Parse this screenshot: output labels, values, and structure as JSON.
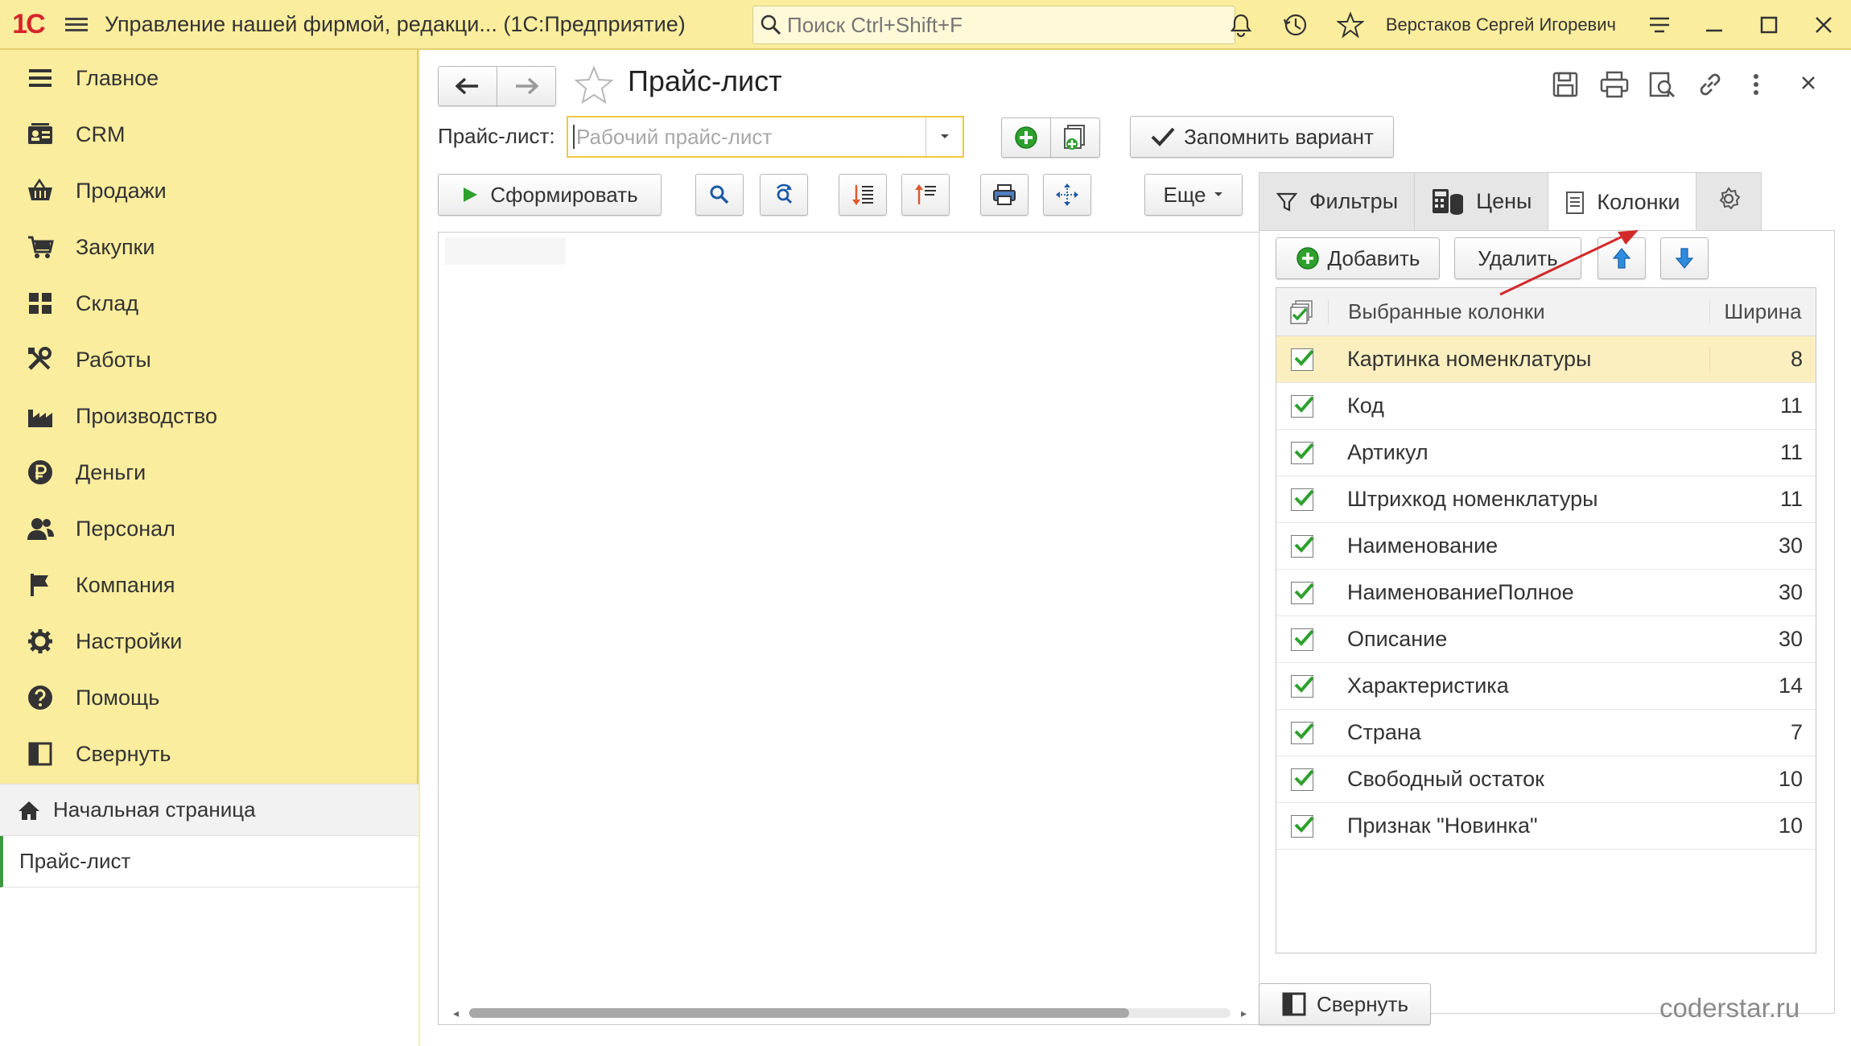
{
  "topbar": {
    "logo": "1С",
    "title": "Управление нашей фирмой, редакци...   (1С:Предприятие)",
    "search_placeholder": "Поиск Ctrl+Shift+F",
    "user": "Верстаков Сергей Игоревич"
  },
  "sidebar": {
    "items": [
      {
        "label": "Главное",
        "icon": "menu-lines-icon"
      },
      {
        "label": "CRM",
        "icon": "crm-card-icon"
      },
      {
        "label": "Продажи",
        "icon": "basket-icon"
      },
      {
        "label": "Закупки",
        "icon": "cart-icon"
      },
      {
        "label": "Склад",
        "icon": "warehouse-grid-icon"
      },
      {
        "label": "Работы",
        "icon": "tools-icon"
      },
      {
        "label": "Производство",
        "icon": "factory-icon"
      },
      {
        "label": "Деньги",
        "icon": "ruble-icon"
      },
      {
        "label": "Персонал",
        "icon": "people-icon"
      },
      {
        "label": "Компания",
        "icon": "flag-icon"
      },
      {
        "label": "Настройки",
        "icon": "gear-icon"
      },
      {
        "label": "Помощь",
        "icon": "help-icon"
      },
      {
        "label": "Свернуть",
        "icon": "collapse-panel-icon"
      }
    ],
    "open_pages": {
      "home": "Начальная страница",
      "current": "Прайс-лист"
    }
  },
  "form": {
    "title": "Прайс-лист",
    "price_list_label": "Прайс-лист:",
    "price_list_placeholder": "Рабочий прайс-лист",
    "remember_variant": "Запомнить вариант",
    "generate": "Сформировать",
    "more": "Еще"
  },
  "tabs": {
    "filters": "Фильтры",
    "prices": "Цены",
    "columns": "Колонки"
  },
  "columns_panel": {
    "add": "Добавить",
    "delete": "Удалить",
    "header_name": "Выбранные колонки",
    "header_width": "Ширина",
    "rows": [
      {
        "name": "Картинка номенклатуры",
        "width": "8",
        "checked": true
      },
      {
        "name": "Код",
        "width": "11",
        "checked": true
      },
      {
        "name": "Артикул",
        "width": "11",
        "checked": true
      },
      {
        "name": "Штрихкод номенклатуры",
        "width": "11",
        "checked": true
      },
      {
        "name": "Наименование",
        "width": "30",
        "checked": true
      },
      {
        "name": "НаименованиеПолное",
        "width": "30",
        "checked": true
      },
      {
        "name": "Описание",
        "width": "30",
        "checked": true
      },
      {
        "name": "Характеристика",
        "width": "14",
        "checked": true
      },
      {
        "name": "Страна",
        "width": "7",
        "checked": true
      },
      {
        "name": "Свободный остаток",
        "width": "10",
        "checked": true
      },
      {
        "name": "Признак \"Новинка\"",
        "width": "10",
        "checked": true
      }
    ],
    "collapse": "Свернуть"
  },
  "watermark": "coderstar.ru",
  "colors": {
    "accent_yellow": "#fbed9e",
    "check_green": "#3b9a3b",
    "arrow_red": "#d22a2a",
    "logo_red": "#d6252b"
  }
}
